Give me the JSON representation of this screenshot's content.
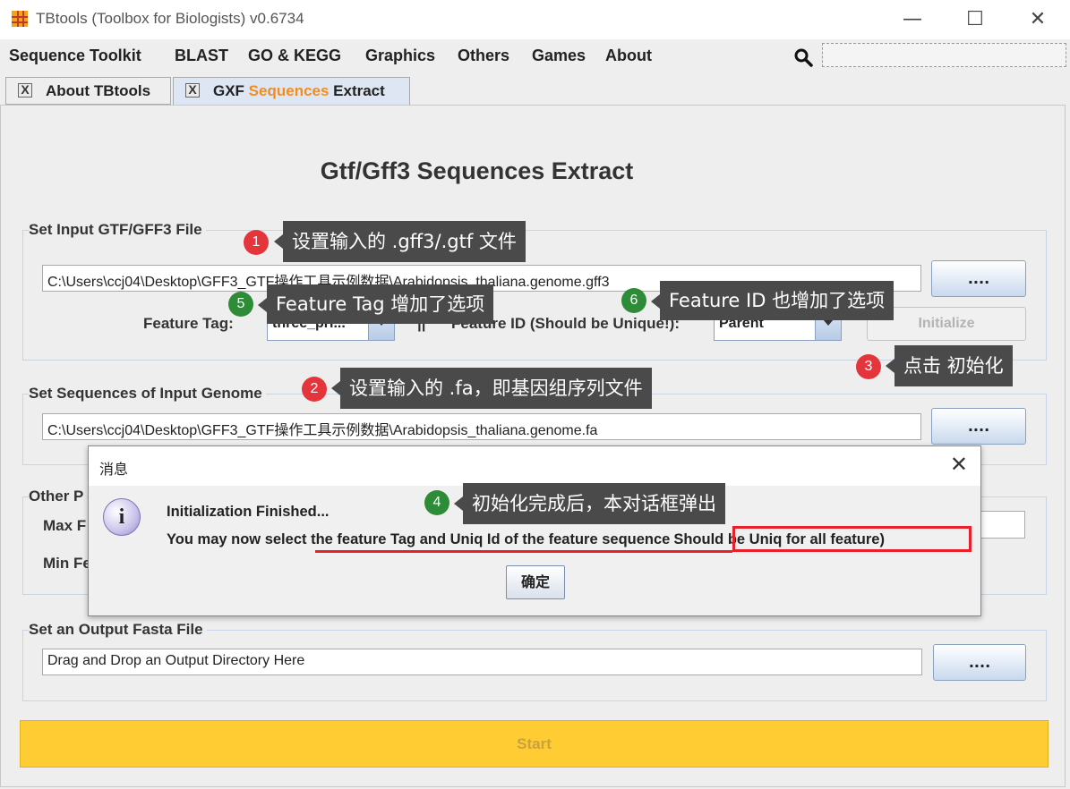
{
  "window": {
    "title": "TBtools (Toolbox for Biologists) v0.6734",
    "minimize": "—",
    "maximize": "☐",
    "close": "✕"
  },
  "menu": [
    "Sequence Toolkit",
    "BLAST",
    "GO & KEGG",
    "Graphics",
    "Others",
    "Games",
    "About"
  ],
  "tabs": {
    "about": "About TBtools",
    "gxf_prefix": "GXF ",
    "gxf_highlight": "Sequences",
    "gxf_suffix": " Extract",
    "close_glyph": "X",
    "highlight_color": "#f28c1e"
  },
  "page": {
    "title": "Gtf/Gff3 Sequences Extract"
  },
  "input_gff": {
    "group_title": "Set Input GTF/GFF3 File",
    "path": "C:\\Users\\ccj04\\Desktop\\GFF3_GTF操作工具示例数据\\Arabidopsis_thaliana.genome.gff3",
    "browse_label": "....",
    "feature_tag_label": "Feature Tag:",
    "feature_tag_value": "three_pri...",
    "separator": "||",
    "feature_id_label": "Feature ID (Should be Unique!):",
    "feature_id_value": "Parent",
    "initialize_label": "Initialize"
  },
  "input_genome": {
    "group_title": "Set Sequences of Input Genome",
    "path": "C:\\Users\\ccj04\\Desktop\\GFF3_GTF操作工具示例数据\\Arabidopsis_thaliana.genome.fa",
    "browse_label": "...."
  },
  "other_params": {
    "group_title": "Other P",
    "max_label": "Max F",
    "min_label": "Min Fe"
  },
  "output": {
    "group_title": "Set an Output Fasta File",
    "path": "Drag and Drop an Output Directory Here",
    "browse_label": "...."
  },
  "start_label": "Start",
  "dialog": {
    "title": "消息",
    "close": "✕",
    "icon": "i",
    "line1": "Initialization Finished...",
    "line2_main": "You may now select the feature Tag and Uniq Id of the feature sequence",
    "line2_boxed": "Should be Uniq for all feature)",
    "ok_label": "确定"
  },
  "annotations": [
    {
      "num": "1",
      "text": "设置输入的 .gff3/.gtf 文件",
      "color": "red"
    },
    {
      "num": "2",
      "text": "设置输入的 .fa，即基因组序列文件",
      "color": "red"
    },
    {
      "num": "3",
      "text": "点击 初始化",
      "color": "red"
    },
    {
      "num": "4",
      "text": "初始化完成后，本对话框弹出",
      "color": "green"
    },
    {
      "num": "5",
      "text": "Feature Tag 增加了选项",
      "color": "green"
    },
    {
      "num": "6",
      "text": "Feature ID 也增加了选项",
      "color": "green"
    }
  ],
  "icons": {
    "app": "tbtools-logo-icon",
    "search": "search-icon",
    "info": "info-icon"
  },
  "colors": {
    "start_button": "#ffcc33",
    "annotation_red": "#e5353c",
    "annotation_green": "#2e8b37",
    "underline_red": "#e8202a"
  }
}
